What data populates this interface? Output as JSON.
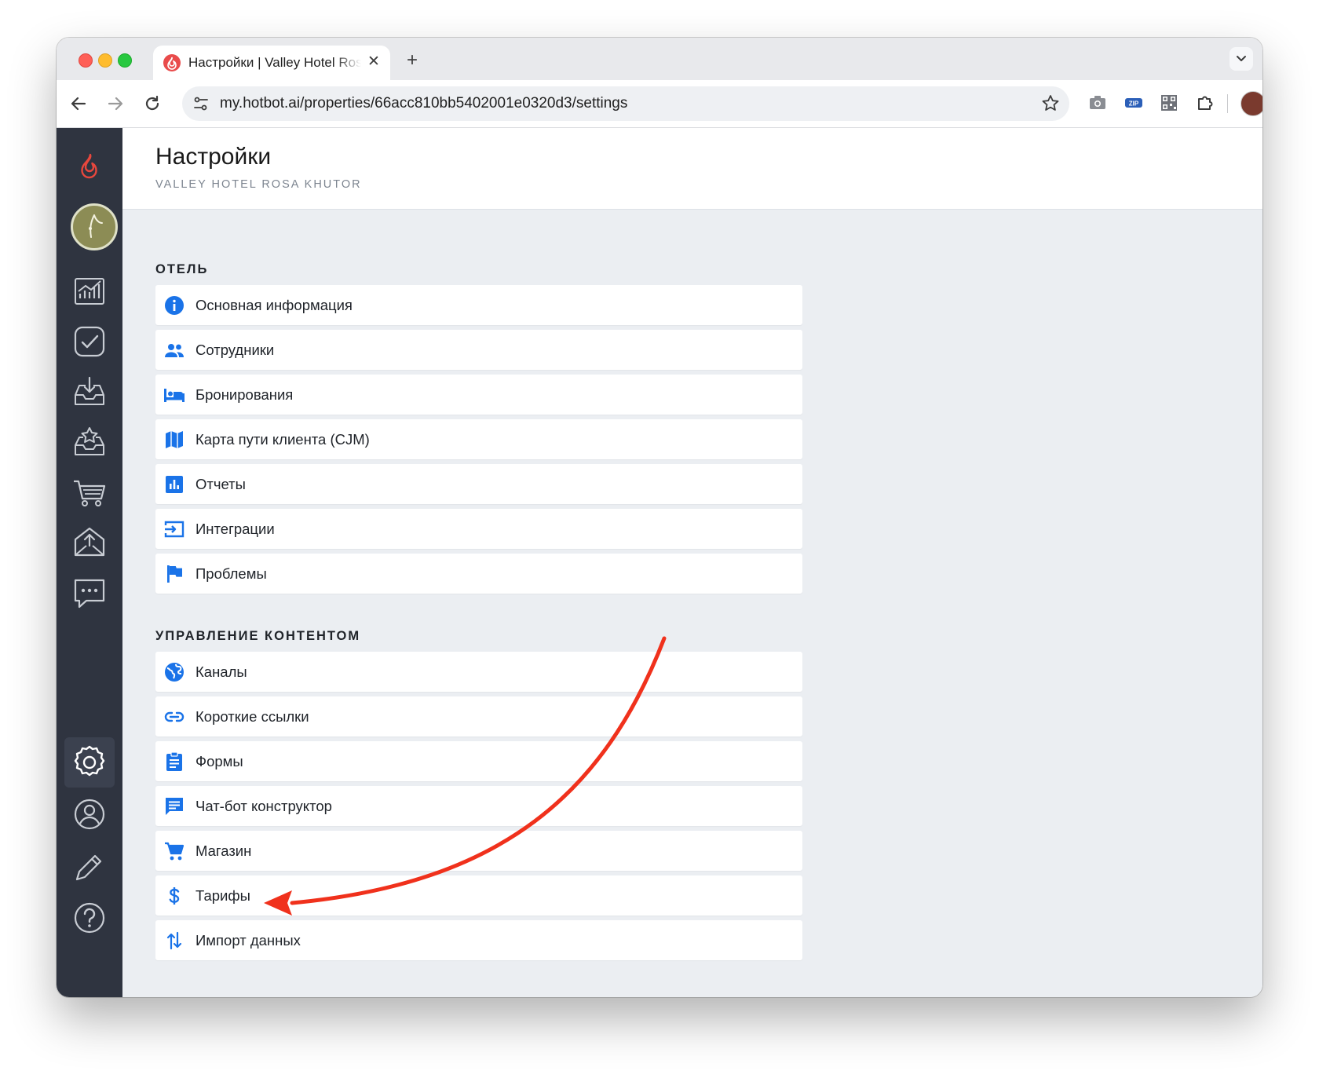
{
  "browser": {
    "tab_title": "Настройки | Valley Hotel Rosa Khutor",
    "url": "my.hotbot.ai/properties/66acc810bb5402001e0320d3/settings",
    "tab_close": "✕",
    "new_tab": "+",
    "ext_zip_label": "ZIP"
  },
  "header": {
    "title": "Настройки",
    "subtitle": "VALLEY HOTEL ROSA KHUTOR"
  },
  "sidebar": {
    "items": [
      {
        "icon": "analytics-icon"
      },
      {
        "icon": "tasks-icon"
      },
      {
        "icon": "inbox-download-icon"
      },
      {
        "icon": "reviews-star-icon"
      },
      {
        "icon": "cart-icon"
      },
      {
        "icon": "mail-upload-icon"
      },
      {
        "icon": "chat-icon"
      },
      {
        "icon": "gear-icon",
        "active": true
      },
      {
        "icon": "user-icon"
      },
      {
        "icon": "pencil-icon"
      },
      {
        "icon": "help-icon"
      }
    ]
  },
  "sections": [
    {
      "title": "ОТЕЛЬ",
      "items": [
        {
          "label": "Основная информация",
          "icon": "info-icon"
        },
        {
          "label": "Сотрудники",
          "icon": "people-icon"
        },
        {
          "label": "Бронирования",
          "icon": "bed-icon"
        },
        {
          "label": "Карта пути клиента (CJM)",
          "icon": "map-icon"
        },
        {
          "label": "Отчеты",
          "icon": "bar-chart-icon"
        },
        {
          "label": "Интеграции",
          "icon": "input-arrow-icon"
        },
        {
          "label": "Проблемы",
          "icon": "flag-icon"
        }
      ]
    },
    {
      "title": "УПРАВЛЕНИЕ КОНТЕНТОМ",
      "items": [
        {
          "label": "Каналы",
          "icon": "globe-icon"
        },
        {
          "label": "Короткие ссылки",
          "icon": "link-icon"
        },
        {
          "label": "Формы",
          "icon": "clipboard-icon"
        },
        {
          "label": "Чат-бот конструктор",
          "icon": "chat-bubble-icon"
        },
        {
          "label": "Магазин",
          "icon": "shopping-cart-icon"
        },
        {
          "label": "Тарифы",
          "icon": "dollar-icon"
        },
        {
          "label": "Импорт данных",
          "icon": "swap-vertical-icon"
        }
      ]
    }
  ],
  "colors": {
    "accent": "#1a73e8",
    "sidebar_bg": "#2f3440",
    "annotation_arrow": "#f0311c"
  }
}
